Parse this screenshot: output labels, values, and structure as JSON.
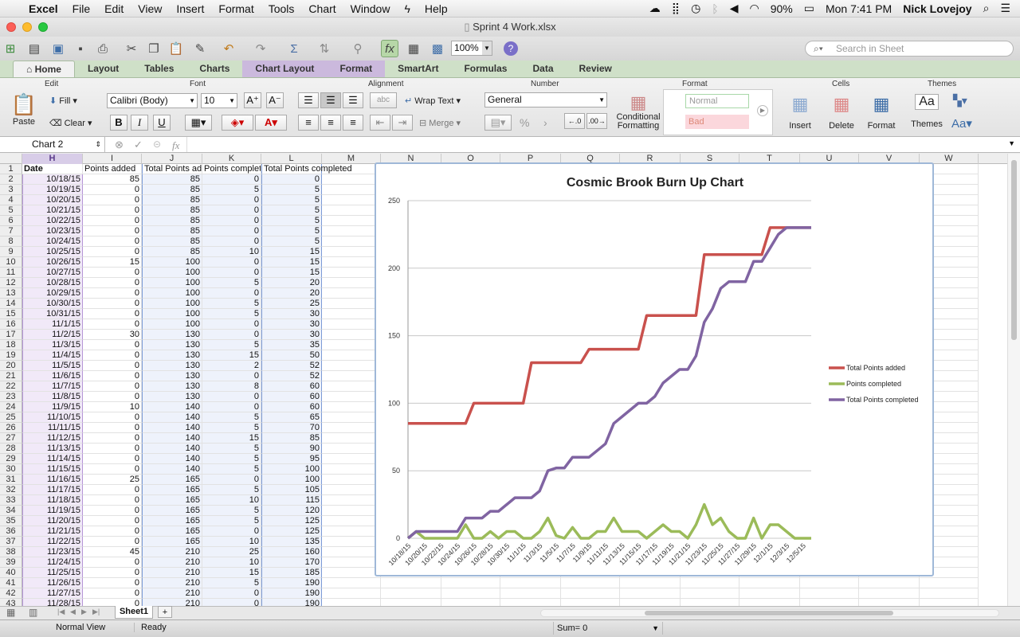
{
  "menubar": {
    "app": "Excel",
    "items": [
      "File",
      "Edit",
      "View",
      "Insert",
      "Format",
      "Tools",
      "Chart",
      "Window",
      "Help"
    ],
    "battery": "90%",
    "clock": "Mon 7:41 PM",
    "user": "Nick Lovejoy"
  },
  "window": {
    "title": "Sprint 4 Work.xlsx"
  },
  "toolbar": {
    "zoom": "100%",
    "search_placeholder": "Search in Sheet"
  },
  "ribbon_tabs": [
    "Home",
    "Layout",
    "Tables",
    "Charts",
    "Chart Layout",
    "Format",
    "SmartArt",
    "Formulas",
    "Data",
    "Review"
  ],
  "ribbon": {
    "edit": {
      "title": "Edit",
      "paste": "Paste",
      "fill": "Fill",
      "clear": "Clear"
    },
    "font": {
      "title": "Font",
      "family": "Calibri (Body)",
      "size": "10",
      "bold": "B",
      "italic": "I",
      "underline": "U"
    },
    "alignment": {
      "title": "Alignment",
      "wrap": "Wrap Text",
      "merge": "Merge",
      "abc": "abc"
    },
    "number": {
      "title": "Number",
      "format": "General",
      "percent": "%"
    },
    "format": {
      "title": "Format",
      "conditional": "Conditional Formatting",
      "normal": "Normal",
      "bad": "Bad"
    },
    "cells": {
      "title": "Cells",
      "insert": "Insert",
      "delete": "Delete",
      "format": "Format"
    },
    "themes": {
      "title": "Themes",
      "themes": "Themes"
    }
  },
  "formula_bar": {
    "name_box": "Chart 2",
    "fx": "fx"
  },
  "columns": [
    "H",
    "I",
    "J",
    "K",
    "L",
    "M",
    "N",
    "O",
    "P",
    "Q",
    "R",
    "S",
    "T",
    "U",
    "V",
    "W"
  ],
  "headers": [
    "Date",
    "Points added",
    "Total Points added",
    "Points completed",
    "Total Points completed"
  ],
  "rows": [
    [
      "10/18/15",
      85,
      85,
      0,
      0
    ],
    [
      "10/19/15",
      0,
      85,
      5,
      5
    ],
    [
      "10/20/15",
      0,
      85,
      0,
      5
    ],
    [
      "10/21/15",
      0,
      85,
      0,
      5
    ],
    [
      "10/22/15",
      0,
      85,
      0,
      5
    ],
    [
      "10/23/15",
      0,
      85,
      0,
      5
    ],
    [
      "10/24/15",
      0,
      85,
      0,
      5
    ],
    [
      "10/25/15",
      0,
      85,
      10,
      15
    ],
    [
      "10/26/15",
      15,
      100,
      0,
      15
    ],
    [
      "10/27/15",
      0,
      100,
      0,
      15
    ],
    [
      "10/28/15",
      0,
      100,
      5,
      20
    ],
    [
      "10/29/15",
      0,
      100,
      0,
      20
    ],
    [
      "10/30/15",
      0,
      100,
      5,
      25
    ],
    [
      "10/31/15",
      0,
      100,
      5,
      30
    ],
    [
      "11/1/15",
      0,
      100,
      0,
      30
    ],
    [
      "11/2/15",
      30,
      130,
      0,
      30
    ],
    [
      "11/3/15",
      0,
      130,
      5,
      35
    ],
    [
      "11/4/15",
      0,
      130,
      15,
      50
    ],
    [
      "11/5/15",
      0,
      130,
      2,
      52
    ],
    [
      "11/6/15",
      0,
      130,
      0,
      52
    ],
    [
      "11/7/15",
      0,
      130,
      8,
      60
    ],
    [
      "11/8/15",
      0,
      130,
      0,
      60
    ],
    [
      "11/9/15",
      10,
      140,
      0,
      60
    ],
    [
      "11/10/15",
      0,
      140,
      5,
      65
    ],
    [
      "11/11/15",
      0,
      140,
      5,
      70
    ],
    [
      "11/12/15",
      0,
      140,
      15,
      85
    ],
    [
      "11/13/15",
      0,
      140,
      5,
      90
    ],
    [
      "11/14/15",
      0,
      140,
      5,
      95
    ],
    [
      "11/15/15",
      0,
      140,
      5,
      100
    ],
    [
      "11/16/15",
      25,
      165,
      0,
      100
    ],
    [
      "11/17/15",
      0,
      165,
      5,
      105
    ],
    [
      "11/18/15",
      0,
      165,
      10,
      115
    ],
    [
      "11/19/15",
      0,
      165,
      5,
      120
    ],
    [
      "11/20/15",
      0,
      165,
      5,
      125
    ],
    [
      "11/21/15",
      0,
      165,
      0,
      125
    ],
    [
      "11/22/15",
      0,
      165,
      10,
      135
    ],
    [
      "11/23/15",
      45,
      210,
      25,
      160
    ],
    [
      "11/24/15",
      0,
      210,
      10,
      170
    ],
    [
      "11/25/15",
      0,
      210,
      15,
      185
    ],
    [
      "11/26/15",
      0,
      210,
      5,
      190
    ],
    [
      "11/27/15",
      0,
      210,
      0,
      190
    ],
    [
      "11/28/15",
      0,
      210,
      0,
      190
    ]
  ],
  "chart_data": {
    "type": "line",
    "title": "Cosmic Brook Burn Up Chart",
    "ylim": [
      0,
      250
    ],
    "yticks": [
      0,
      50,
      100,
      150,
      200,
      250
    ],
    "grid": true,
    "legend_position": "right",
    "x_tick_labels": [
      "10/18/15",
      "10/20/15",
      "10/22/15",
      "10/24/15",
      "10/26/15",
      "10/28/15",
      "10/30/15",
      "11/1/15",
      "11/3/15",
      "11/5/15",
      "11/7/15",
      "11/9/15",
      "11/11/15",
      "11/13/15",
      "11/15/15",
      "11/17/15",
      "11/19/15",
      "11/21/15",
      "11/23/15",
      "11/25/15",
      "11/27/15",
      "11/29/15",
      "12/1/15",
      "12/3/15",
      "12/5/15"
    ],
    "x": [
      "10/18/15",
      "10/19/15",
      "10/20/15",
      "10/21/15",
      "10/22/15",
      "10/23/15",
      "10/24/15",
      "10/25/15",
      "10/26/15",
      "10/27/15",
      "10/28/15",
      "10/29/15",
      "10/30/15",
      "10/31/15",
      "11/1/15",
      "11/2/15",
      "11/3/15",
      "11/4/15",
      "11/5/15",
      "11/6/15",
      "11/7/15",
      "11/8/15",
      "11/9/15",
      "11/10/15",
      "11/11/15",
      "11/12/15",
      "11/13/15",
      "11/14/15",
      "11/15/15",
      "11/16/15",
      "11/17/15",
      "11/18/15",
      "11/19/15",
      "11/20/15",
      "11/21/15",
      "11/22/15",
      "11/23/15",
      "11/24/15",
      "11/25/15",
      "11/26/15",
      "11/27/15",
      "11/28/15",
      "11/29/15",
      "11/30/15",
      "12/1/15",
      "12/2/15",
      "12/3/15",
      "12/4/15",
      "12/5/15",
      "12/6/15"
    ],
    "series": [
      {
        "name": "Total Points added",
        "color": "#c9514d",
        "values": [
          85,
          85,
          85,
          85,
          85,
          85,
          85,
          85,
          100,
          100,
          100,
          100,
          100,
          100,
          100,
          130,
          130,
          130,
          130,
          130,
          130,
          130,
          140,
          140,
          140,
          140,
          140,
          140,
          140,
          165,
          165,
          165,
          165,
          165,
          165,
          165,
          210,
          210,
          210,
          210,
          210,
          210,
          210,
          210,
          230,
          230,
          230,
          230,
          230,
          230
        ]
      },
      {
        "name": "Points completed",
        "color": "#9bbb59",
        "values": [
          0,
          5,
          0,
          0,
          0,
          0,
          0,
          10,
          0,
          0,
          5,
          0,
          5,
          5,
          0,
          0,
          5,
          15,
          2,
          0,
          8,
          0,
          0,
          5,
          5,
          15,
          5,
          5,
          5,
          0,
          5,
          10,
          5,
          5,
          0,
          10,
          25,
          10,
          15,
          5,
          0,
          0,
          15,
          0,
          10,
          10,
          5,
          0,
          0,
          0
        ]
      },
      {
        "name": "Total Points completed",
        "color": "#8064a2",
        "values": [
          0,
          5,
          5,
          5,
          5,
          5,
          5,
          15,
          15,
          15,
          20,
          20,
          25,
          30,
          30,
          30,
          35,
          50,
          52,
          52,
          60,
          60,
          60,
          65,
          70,
          85,
          90,
          95,
          100,
          100,
          105,
          115,
          120,
          125,
          125,
          135,
          160,
          170,
          185,
          190,
          190,
          190,
          205,
          205,
          215,
          225,
          230,
          230,
          230,
          230
        ]
      }
    ]
  },
  "sheet_tabs": [
    "Sheet1"
  ],
  "status": {
    "view": "Normal View",
    "state": "Ready",
    "sum": "Sum= 0"
  }
}
